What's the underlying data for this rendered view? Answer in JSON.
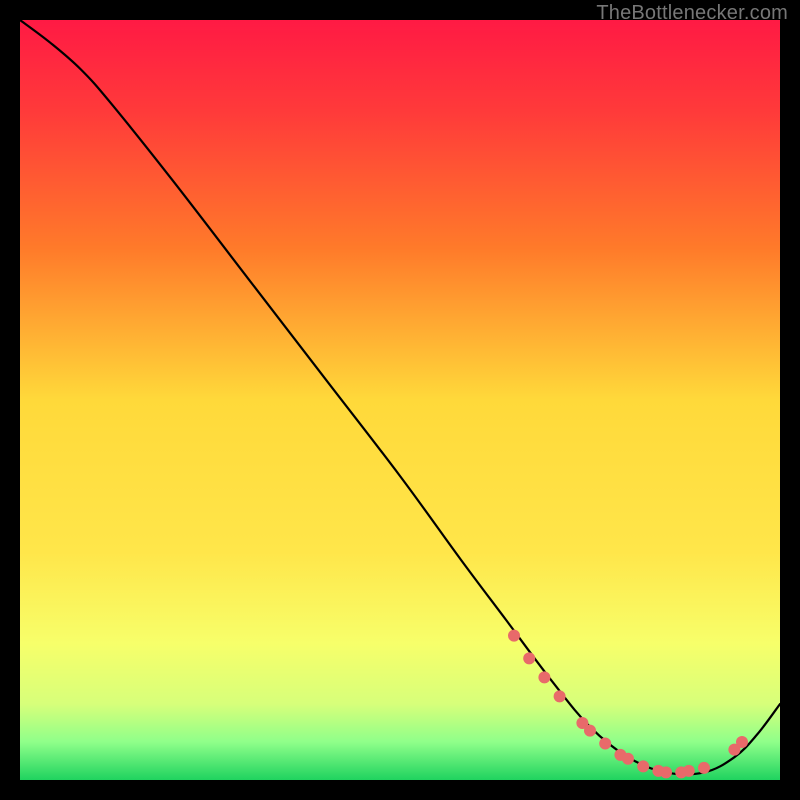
{
  "watermark": "TheBottlenecker.com",
  "chart_data": {
    "type": "line",
    "title": "",
    "xlabel": "",
    "ylabel": "",
    "xlim": [
      0,
      100
    ],
    "ylim": [
      0,
      100
    ],
    "background_gradient_stops": [
      {
        "offset": 0.0,
        "color": "#ff1a44"
      },
      {
        "offset": 0.12,
        "color": "#ff3a3a"
      },
      {
        "offset": 0.3,
        "color": "#ff7a2a"
      },
      {
        "offset": 0.5,
        "color": "#ffd93a"
      },
      {
        "offset": 0.7,
        "color": "#ffe64a"
      },
      {
        "offset": 0.82,
        "color": "#f7ff6a"
      },
      {
        "offset": 0.9,
        "color": "#d7ff7a"
      },
      {
        "offset": 0.95,
        "color": "#8fff8a"
      },
      {
        "offset": 1.0,
        "color": "#1fd35f"
      }
    ],
    "series": [
      {
        "name": "curve",
        "x": [
          0,
          4,
          8,
          12,
          20,
          30,
          40,
          50,
          58,
          64,
          70,
          75,
          80,
          85,
          90,
          94,
          97,
          100
        ],
        "y": [
          100,
          97,
          93.5,
          89,
          79,
          66,
          53,
          40,
          29,
          21,
          13,
          7,
          3,
          1,
          1,
          3,
          6,
          10
        ]
      }
    ],
    "scatter_points": {
      "name": "highlight-dots",
      "color": "#e86a6a",
      "radius": 6,
      "points": [
        {
          "x": 65,
          "y": 19
        },
        {
          "x": 67,
          "y": 16
        },
        {
          "x": 69,
          "y": 13.5
        },
        {
          "x": 71,
          "y": 11
        },
        {
          "x": 74,
          "y": 7.5
        },
        {
          "x": 75,
          "y": 6.5
        },
        {
          "x": 77,
          "y": 4.8
        },
        {
          "x": 79,
          "y": 3.3
        },
        {
          "x": 80,
          "y": 2.8
        },
        {
          "x": 82,
          "y": 1.8
        },
        {
          "x": 84,
          "y": 1.2
        },
        {
          "x": 85,
          "y": 1.0
        },
        {
          "x": 87,
          "y": 1.0
        },
        {
          "x": 88,
          "y": 1.2
        },
        {
          "x": 90,
          "y": 1.6
        },
        {
          "x": 94,
          "y": 4.0
        },
        {
          "x": 95,
          "y": 5.0
        }
      ]
    }
  }
}
